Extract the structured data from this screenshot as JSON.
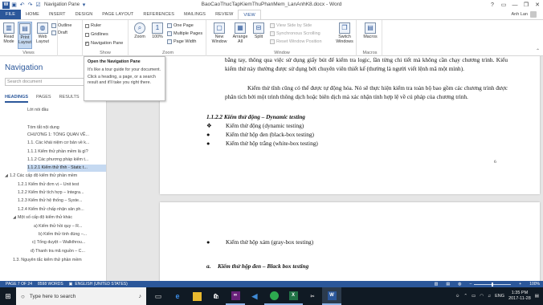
{
  "titlebar": {
    "qat_label": "Navigation Pane",
    "doc_title": "BaoCaoThucTapKiemThuPhanMem_LanAnhK8.docx - Word",
    "help": "?",
    "minimize": "—",
    "restore": "❐",
    "close": "✕"
  },
  "tabs": [
    "FILE",
    "HOME",
    "INSERT",
    "DESIGN",
    "PAGE LAYOUT",
    "REFERENCES",
    "MAILINGS",
    "REVIEW",
    "VIEW"
  ],
  "user": {
    "name": "Anh Lan"
  },
  "ribbon": {
    "views": {
      "read_mode": "Read Mode",
      "print_layout": "Print Layout",
      "web_layout": "Web Layout",
      "outline": "Outline",
      "draft": "Draft",
      "label": "Views"
    },
    "show": {
      "ruler": "Ruler",
      "gridlines": "Gridlines",
      "nav_pane": "Navigation Pane",
      "label": "Show"
    },
    "zoom": {
      "zoom": "Zoom",
      "pct": "100%",
      "one_page": "One Page",
      "multiple_pages": "Multiple Pages",
      "page_width": "Page Width",
      "label": "Zoom"
    },
    "window": {
      "new_window": "New Window",
      "arrange_all": "Arrange All",
      "split": "Split",
      "side_by_side": "View Side by Side",
      "sync_scroll": "Synchronous Scrolling",
      "reset_pos": "Reset Window Position",
      "switch_windows": "Switch Windows",
      "label": "Window"
    },
    "macros": {
      "macros": "Macros",
      "label": "Macros"
    }
  },
  "tooltip": {
    "title": "Open the Navigation Pane",
    "p1": "It's like a tour guide for your document.",
    "p2": "Click a heading, a page, or a search result and it'll take you right there."
  },
  "nav": {
    "title": "Navigation",
    "search_placeholder": "Search document",
    "tabs": [
      "HEADINGS",
      "PAGES",
      "RESULTS"
    ],
    "headings": [
      "Lời nói đầu",
      "Tóm tắt nội dung",
      "CHƯƠNG 1: TỔNG QUAN VỀ...",
      "1.1. Các khái niệm cơ bản về k...",
      "1.1.1 Kiểm thử phần mềm là gì?",
      "1.1.2 Các phương pháp kiểm t...",
      "1.1.2.1 Kiểm thử tĩnh - Static t...",
      "1.2 Các cấp độ kiểm thử phần mềm",
      "1.2.1 Kiểm thử đơn vị – Unit test",
      "1.2.2 Kiểm thử tích hợp – Integra...",
      "1.2.3 Kiểm thử hệ thống – Syste...",
      "1.2.4 Kiểm thử chấp nhận sản ph...",
      "Một số cấp độ kiểm thử khác",
      "a) Kiểm thử hồi quy – R...",
      "b) Kiểm thử tính đúng –...",
      "c) Tổng duyệt – Walkthrou...",
      "d) Thanh tra mã nguồn – C...",
      "1.3. Nguyên tắc kiểm thử phần mềm"
    ]
  },
  "doc": {
    "p1": "bằng tay, thông qua việc sử dụng giấy bút để kiểm tra logic, lần từng chi tiết mà không cần chạy chương trình. Kiểu kiểm thử này thường được sử dụng bởi chuyên viên thiết kế (thường là người viết lệnh mã một mình).",
    "p2": "Kiểm thử tĩnh cũng có thể được tự động hóa. Nó sẽ thực hiện kiểm tra toàn bộ bao gồm các chương trình được phân tích bởi một trình thông dịch hoặc biên dịch mà xác nhận tính hợp lệ về cú pháp của chương trình.",
    "heading": "1.1.2.2 Kiểm thử động – Dynamic testing",
    "bullets": [
      {
        "marker": "❖",
        "text": "Kiểm thử động (dynamic testing)"
      },
      {
        "marker": "●",
        "text": "Kiểm thử hộp đen (black-box testing)"
      },
      {
        "marker": "●",
        "text": "Kiểm thử hộp trắng (white-box testing)"
      }
    ],
    "page_number": "6",
    "p2_bullet": {
      "marker": "●",
      "text": "Kiểm thử hộp xám (gray-box testing)"
    },
    "p2_heading": {
      "marker": "a.",
      "text": "Kiểm thử hộp đen – Black box testing"
    }
  },
  "status": {
    "page": "PAGE 7 OF 24",
    "words": "8598 WORDS",
    "lang": "ENGLISH (UNITED STATES)",
    "zoom": "100%"
  },
  "taskbar": {
    "search": "Type here to search",
    "lang": "ENG",
    "time": "1:35 PM",
    "date": "2017-11-28"
  }
}
